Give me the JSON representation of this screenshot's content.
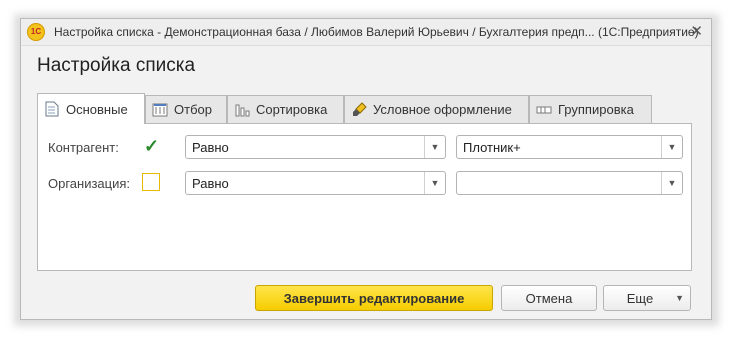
{
  "window": {
    "title": "Настройка списка - Демонстрационная база / Любимов Валерий Юрьевич / Бухгалтерия предп... (1С:Предприятие)",
    "logo_text": "1С",
    "close_glyph": "✕"
  },
  "form": {
    "title": "Настройка списка"
  },
  "tabs": [
    {
      "label": "Основные",
      "icon": "document-icon",
      "active": true
    },
    {
      "label": "Отбор",
      "icon": "filter-icon",
      "active": false
    },
    {
      "label": "Сортировка",
      "icon": "sort-icon",
      "active": false
    },
    {
      "label": "Условное оформление",
      "icon": "brush-icon",
      "active": false
    },
    {
      "label": "Группировка",
      "icon": "grouping-icon",
      "active": false
    }
  ],
  "rows": [
    {
      "label": "Контрагент:",
      "checked": true,
      "condition": "Равно",
      "value": "Плотник+"
    },
    {
      "label": "Организация:",
      "checked": false,
      "condition": "Равно",
      "value": ""
    }
  ],
  "dropdown_glyph": "▼",
  "buttons": {
    "finish_label": "Завершить редактирование",
    "cancel_label": "Отмена",
    "more_label": "Еще"
  },
  "colors": {
    "primary_button": "#f6cd00",
    "check_mark": "#2a8a2a",
    "focus_border": "#e8b900"
  }
}
